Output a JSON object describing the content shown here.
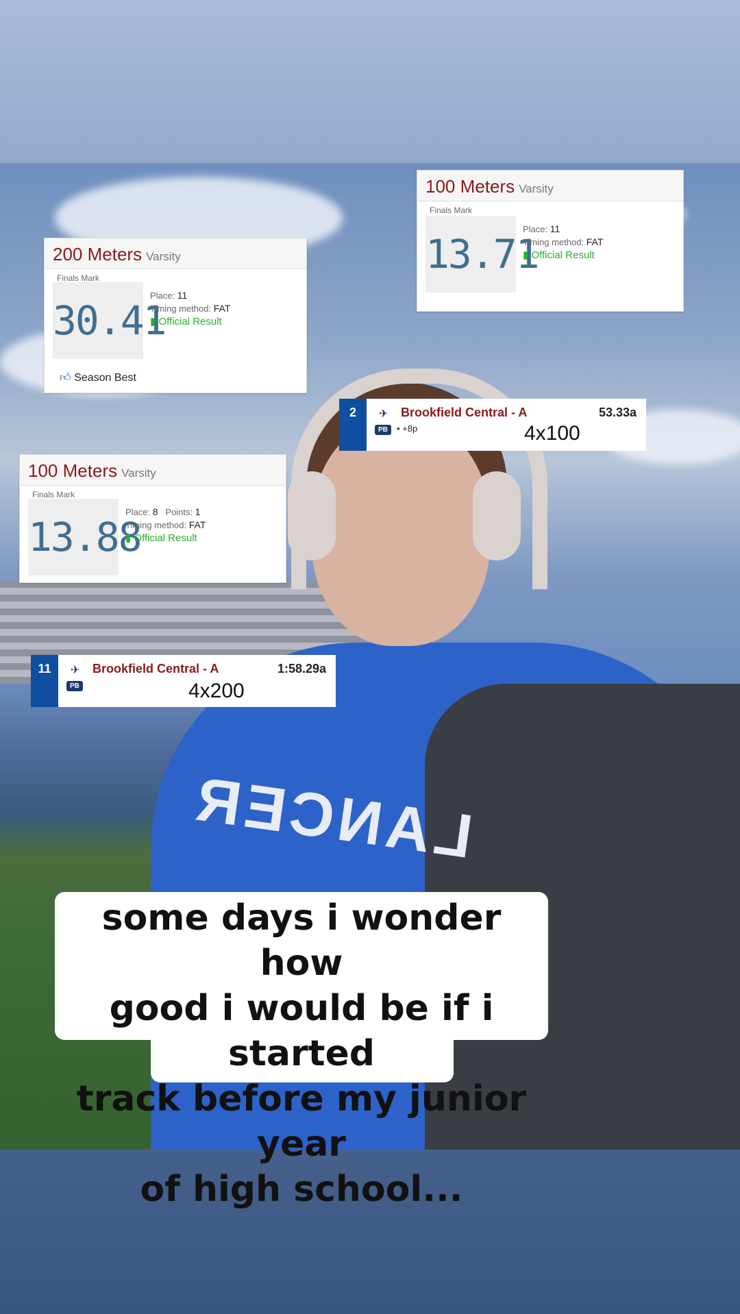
{
  "cards": {
    "c200": {
      "event": "200 Meters",
      "level": "Varsity",
      "finals": "Finals Mark",
      "mark": "30.41",
      "place_label": "Place:",
      "place": "11",
      "timing_label": "Timing method:",
      "timing": "FAT",
      "official": "Official Result",
      "season": "Season Best"
    },
    "c100a": {
      "event": "100 Meters",
      "level": "Varsity",
      "finals": "Finals Mark",
      "mark": "13.71",
      "place_label": "Place:",
      "place": "11",
      "timing_label": "Timing method:",
      "timing": "FAT",
      "official": "Official Result"
    },
    "c100b": {
      "event": "100 Meters",
      "level": "Varsity",
      "finals": "Finals Mark",
      "mark": "13.88",
      "place_label": "Place:",
      "place": "8",
      "points_label": "Points:",
      "points": "1",
      "timing_label": "Timing method:",
      "timing": "FAT",
      "official": "Official Result"
    }
  },
  "relays": {
    "r4x100": {
      "place": "2",
      "team": "Brookfield Central - A",
      "time": "53.33a",
      "pb": "PB",
      "extra": "• +8p",
      "label": "4x100"
    },
    "r4x200": {
      "place": "11",
      "team": "Brookfield Central - A",
      "time": "1:58.29a",
      "pb": "PB",
      "label": "4x200"
    }
  },
  "caption": {
    "line1": "some days i wonder how",
    "line2": "good i would be if i started",
    "line3": "track before my junior year",
    "line4": "of high school..."
  },
  "shirt_text": "LANCER",
  "colors": {
    "event_red": "#8b1a1a",
    "official_green": "#2bb02b",
    "relay_blue": "#0f4ea0",
    "mark_blue": "#3f6f8f"
  }
}
